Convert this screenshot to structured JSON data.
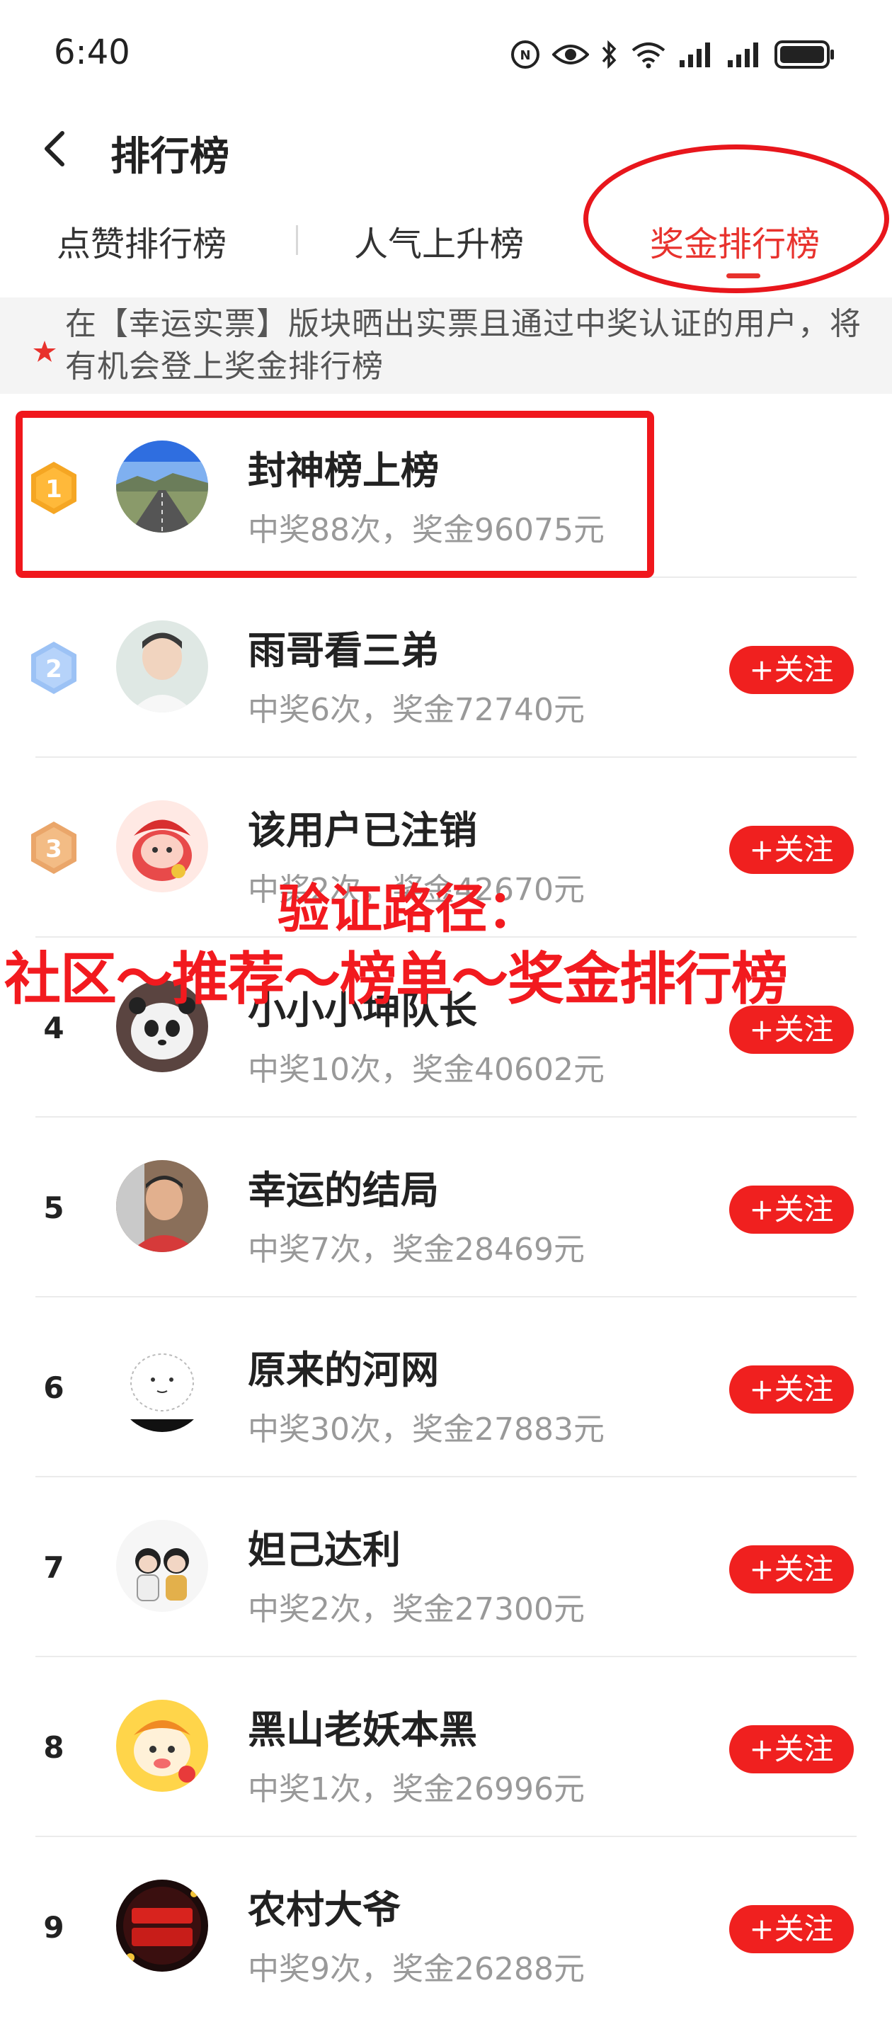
{
  "status_bar": {
    "time": "6:40"
  },
  "header": {
    "title": "排行榜"
  },
  "tabs": [
    {
      "label": "点赞排行榜"
    },
    {
      "label": "人气上升榜"
    },
    {
      "label": "奖金排行榜",
      "active": true
    }
  ],
  "notice": {
    "text": "在【幸运实票】版块晒出实票且通过中奖认证的用户，将有机会登上奖金排行榜"
  },
  "follow_label": "+关注",
  "users": [
    {
      "rank": "1",
      "name": "封神榜上榜",
      "stats": "中奖88次，奖金96075元"
    },
    {
      "rank": "2",
      "name": "雨哥看三弟",
      "stats": "中奖6次，奖金72740元"
    },
    {
      "rank": "3",
      "name": "该用户已注销",
      "stats": "中奖2次，奖金42670元"
    },
    {
      "rank": "4",
      "name": "小小小坤队长",
      "stats": "中奖10次，奖金40602元"
    },
    {
      "rank": "5",
      "name": "幸运的结局",
      "stats": "中奖7次，奖金28469元"
    },
    {
      "rank": "6",
      "name": "原来的河网",
      "stats": "中奖30次，奖金27883元"
    },
    {
      "rank": "7",
      "name": "妲己达利",
      "stats": "中奖2次，奖金27300元"
    },
    {
      "rank": "8",
      "name": "黑山老妖本黑",
      "stats": "中奖1次，奖金26996元"
    },
    {
      "rank": "9",
      "name": "农村大爷",
      "stats": "中奖9次，奖金26288元"
    }
  ],
  "annotation": {
    "line1": "验证路径：",
    "line2": "社区～推荐～榜单～奖金排行榜"
  },
  "colors": {
    "accent": "#e8322d",
    "rank1": "#f5a623",
    "rank2": "#8ab4f0",
    "rank3": "#e9a86a"
  }
}
